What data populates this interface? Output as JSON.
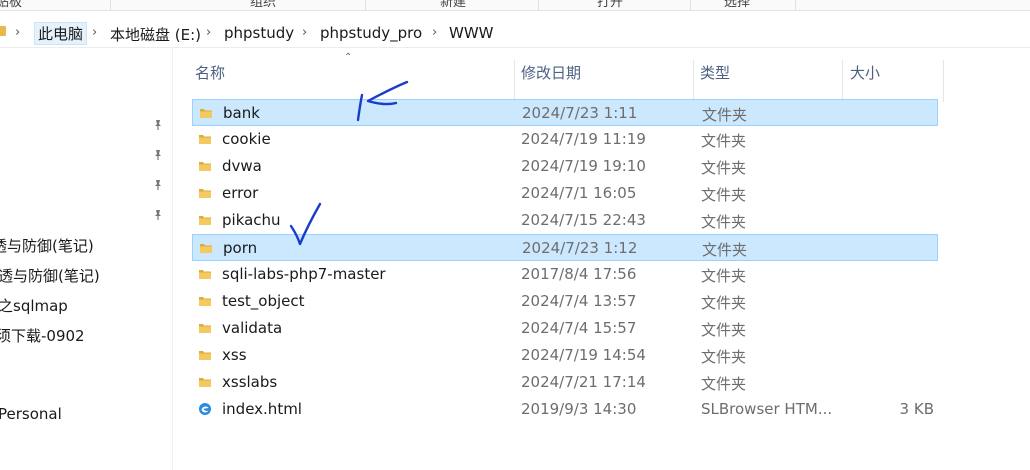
{
  "ribbon": {
    "groups": [
      "组织",
      "新建",
      "打开",
      "选择"
    ],
    "left_fragment": "贴板"
  },
  "address": {
    "crumbs": [
      "此电脑",
      "本地磁盘 (E:)",
      "phpstudy",
      "phpstudy_pro",
      "WWW"
    ]
  },
  "nav": {
    "items": [
      "透与防御(笔记)",
      "透与防御(笔记)",
      "之sqlmap",
      "须下载-0902",
      "Personal"
    ]
  },
  "columns": {
    "name": "名称",
    "modified": "修改日期",
    "type": "类型",
    "size": "大小"
  },
  "files": [
    {
      "name": "bank",
      "modified": "2024/7/23 1:11",
      "type": "文件夹",
      "size": "",
      "icon": "folder-icon",
      "selected": true
    },
    {
      "name": "cookie",
      "modified": "2024/7/19 11:19",
      "type": "文件夹",
      "size": "",
      "icon": "folder-icon",
      "selected": false
    },
    {
      "name": "dvwa",
      "modified": "2024/7/19 19:10",
      "type": "文件夹",
      "size": "",
      "icon": "folder-icon",
      "selected": false
    },
    {
      "name": "error",
      "modified": "2024/7/1 16:05",
      "type": "文件夹",
      "size": "",
      "icon": "folder-icon",
      "selected": false
    },
    {
      "name": "pikachu",
      "modified": "2024/7/15 22:43",
      "type": "文件夹",
      "size": "",
      "icon": "folder-icon",
      "selected": false
    },
    {
      "name": "porn",
      "modified": "2024/7/23 1:12",
      "type": "文件夹",
      "size": "",
      "icon": "folder-icon",
      "selected": true
    },
    {
      "name": "sqli-labs-php7-master",
      "modified": "2017/8/4 17:56",
      "type": "文件夹",
      "size": "",
      "icon": "folder-icon",
      "selected": false
    },
    {
      "name": "test_object",
      "modified": "2024/7/4 13:57",
      "type": "文件夹",
      "size": "",
      "icon": "folder-icon",
      "selected": false
    },
    {
      "name": "validata",
      "modified": "2024/7/4 15:57",
      "type": "文件夹",
      "size": "",
      "icon": "folder-icon",
      "selected": false
    },
    {
      "name": "xss",
      "modified": "2024/7/19 14:54",
      "type": "文件夹",
      "size": "",
      "icon": "folder-icon",
      "selected": false
    },
    {
      "name": "xsslabs",
      "modified": "2024/7/21 17:14",
      "type": "文件夹",
      "size": "",
      "icon": "folder-icon",
      "selected": false
    },
    {
      "name": "index.html",
      "modified": "2019/9/3 14:30",
      "type": "SLBrowser HTM...",
      "size": "3 KB",
      "icon": "browser-html-icon",
      "selected": false
    }
  ],
  "colors": {
    "selection_bg": "#cce8ff",
    "selection_border": "#99d1ff",
    "folder": "#e8b84a",
    "annotation_ink": "#1a3cc8"
  }
}
